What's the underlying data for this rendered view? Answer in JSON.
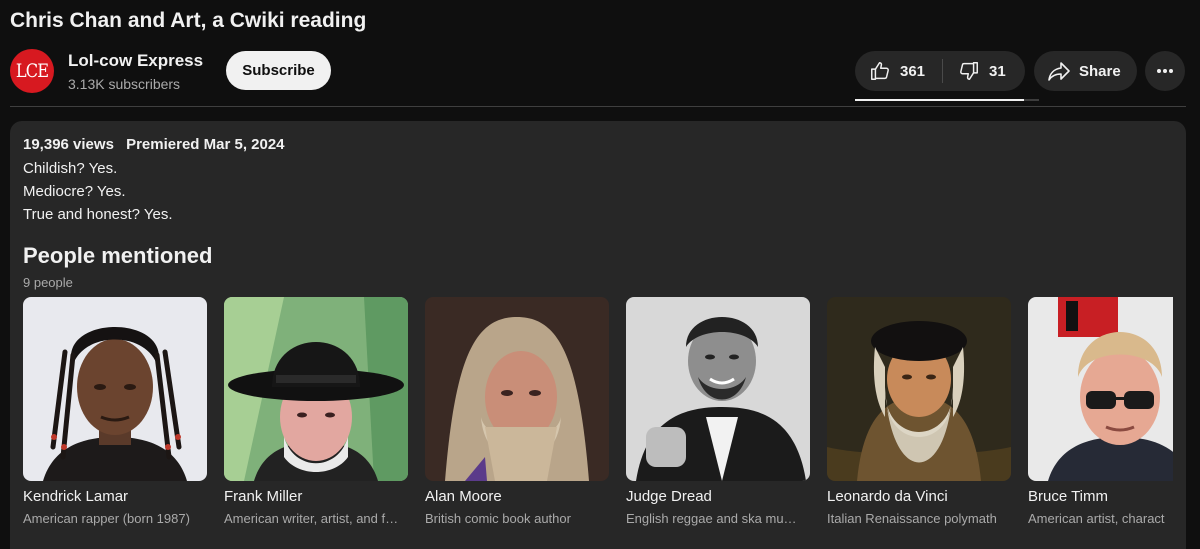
{
  "video": {
    "title": "Chris Chan and Art, a Cwiki reading"
  },
  "channel": {
    "avatar_text": "LCE",
    "name": "Lol-cow Express",
    "subscribers": "3.13K subscribers",
    "subscribe_label": "Subscribe"
  },
  "actions": {
    "likes": "361",
    "dislikes": "31",
    "share_label": "Share",
    "like_ratio": 0.92
  },
  "description": {
    "views": "19,396 views",
    "premiered": "Premiered Mar 5, 2024",
    "lines": [
      "Childish? Yes.",
      "Mediocre? Yes.",
      "True and honest? Yes."
    ]
  },
  "people": {
    "title": "People mentioned",
    "count": "9 people",
    "items": [
      {
        "name": "Kendrick Lamar",
        "desc": "American rapper (born 1987)"
      },
      {
        "name": "Frank Miller",
        "desc": "American writer, artist, and film director"
      },
      {
        "name": "Alan Moore",
        "desc": "British comic book author"
      },
      {
        "name": "Judge Dread",
        "desc": "English reggae and ska musician"
      },
      {
        "name": "Leonardo da Vinci",
        "desc": "Italian Renaissance polymath"
      },
      {
        "name": "Bruce Timm",
        "desc": "American artist, charact"
      }
    ]
  },
  "colors": {
    "background": "#0f0f0f",
    "surface": "#272727",
    "text": "#f1f1f1",
    "secondary_text": "#aaaaaa",
    "avatar_red": "#d71920"
  },
  "icons": [
    "thumb-up-icon",
    "thumb-down-icon",
    "share-arrow-icon",
    "more-vert-icon"
  ]
}
